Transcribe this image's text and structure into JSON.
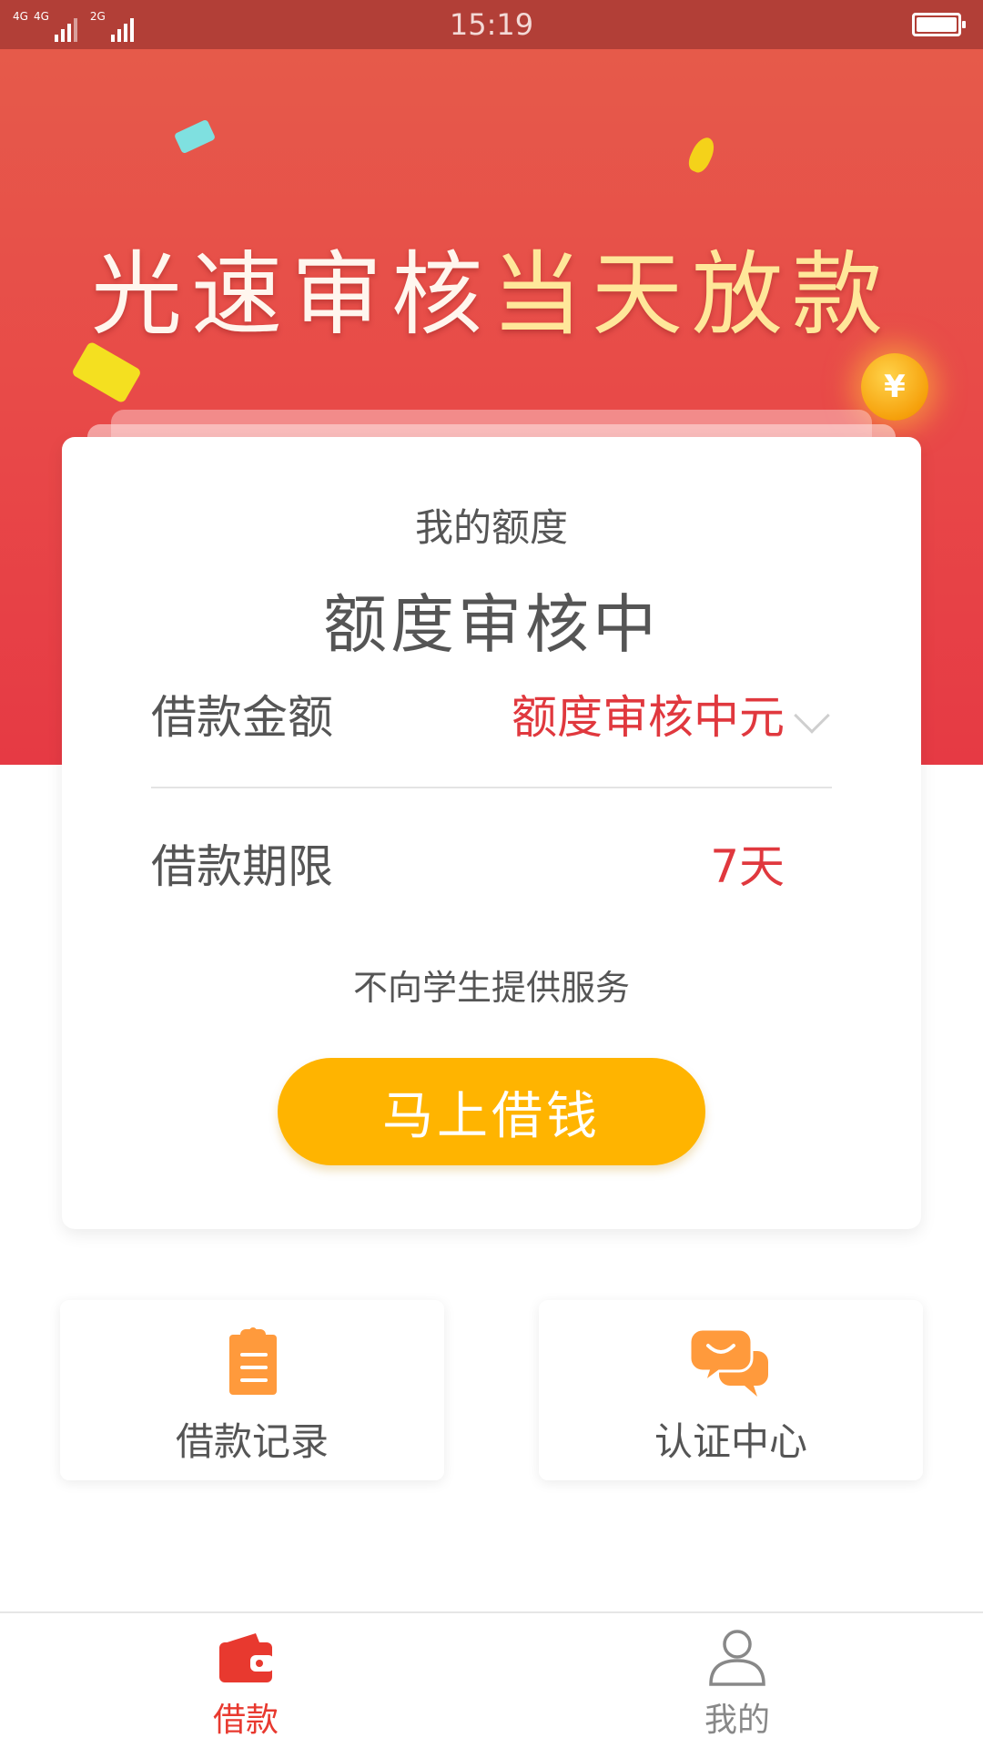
{
  "status_bar": {
    "network_1": "4G",
    "network_2": "4G",
    "network_3": "2G",
    "time": "15:19"
  },
  "banner": {
    "title_part_1": "光速审核",
    "title_part_2": "当天放款",
    "coin_symbol": "¥"
  },
  "quota_card": {
    "label": "我的额度",
    "status": "额度审核中",
    "amount_label": "借款金额",
    "amount_value": "额度审核中元",
    "term_label": "借款期限",
    "term_value": "7天",
    "notice": "不向学生提供服务",
    "borrow_button": "马上借钱"
  },
  "features": [
    {
      "label": "借款记录",
      "icon": "clipboard-icon"
    },
    {
      "label": "认证中心",
      "icon": "chat-bubbles-icon"
    }
  ],
  "bottom_nav": [
    {
      "label": "借款",
      "icon": "wallet-icon",
      "active": true
    },
    {
      "label": "我的",
      "icon": "user-icon",
      "active": false
    }
  ],
  "colors": {
    "brand_red": "#e84848",
    "accent_yellow": "#ffb400",
    "value_red": "#e0383e",
    "icon_orange": "#ff9a3c",
    "nav_active": "#e8392f"
  }
}
